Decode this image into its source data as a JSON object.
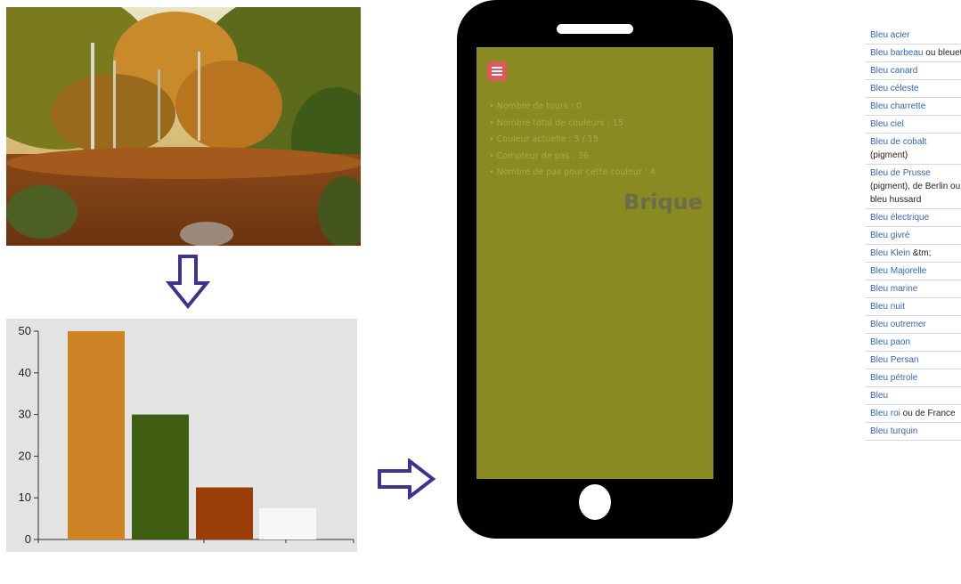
{
  "photo": {
    "description_icon": "autumn-forest-photo"
  },
  "arrows": {
    "down": "down-arrow-icon",
    "right": "right-arrow-icon"
  },
  "chart_data": {
    "type": "bar",
    "categories": [
      "",
      "",
      "",
      ""
    ],
    "values": [
      50,
      30,
      12.5,
      7.5
    ],
    "colors": [
      "#cf8327",
      "#3f5e12",
      "#9a3d06",
      "#f7f7f7"
    ],
    "ylim": [
      0,
      50
    ],
    "yticks": [
      0,
      10,
      20,
      30,
      40,
      50
    ],
    "grid": false,
    "title": "",
    "xlabel": "",
    "ylabel": ""
  },
  "phone": {
    "screen_color": "#8a8a22",
    "menu_icon": "hamburger-menu-icon",
    "stats": [
      "Nombre de tours : 0",
      "Nombre total de couleurs : 15",
      "Couleur actuelle : 5 / 15",
      "Compteur de pas : 36",
      "Nombre de pas pour cette couleur : 4"
    ],
    "color_name": "Brique"
  },
  "color_list": [
    {
      "link": "Bleu acier",
      "rest": ""
    },
    {
      "link": "Bleu barbeau",
      "rest": " ou bleuet"
    },
    {
      "link": "Bleu canard",
      "rest": ""
    },
    {
      "link": "Bleu céleste",
      "rest": ""
    },
    {
      "link": "Bleu charrette",
      "rest": ""
    },
    {
      "link": "Bleu ciel",
      "rest": ""
    },
    {
      "link": "Bleu de cobalt",
      "rest": " (pigment)"
    },
    {
      "link": "Bleu de Prusse",
      "rest": " (pigment), de Berlin ou bleu hussard"
    },
    {
      "link": "Bleu électrique",
      "rest": ""
    },
    {
      "link": "Bleu givré",
      "rest": ""
    },
    {
      "link": "Bleu Klein",
      "rest": " &tm;"
    },
    {
      "link": "Bleu Majorelle",
      "rest": ""
    },
    {
      "link": "Bleu marine",
      "rest": ""
    },
    {
      "link": "Bleu nuit",
      "rest": ""
    },
    {
      "link": "Bleu outremer",
      "rest": ""
    },
    {
      "link": "Bleu paon",
      "rest": ""
    },
    {
      "link": "Bleu Persan",
      "rest": ""
    },
    {
      "link": "Bleu pétrole",
      "rest": ""
    },
    {
      "link": "Bleu",
      "rest": ""
    },
    {
      "link": "Bleu roi",
      "rest": " ou de France"
    },
    {
      "link": "Bleu turquin",
      "rest": ""
    }
  ]
}
